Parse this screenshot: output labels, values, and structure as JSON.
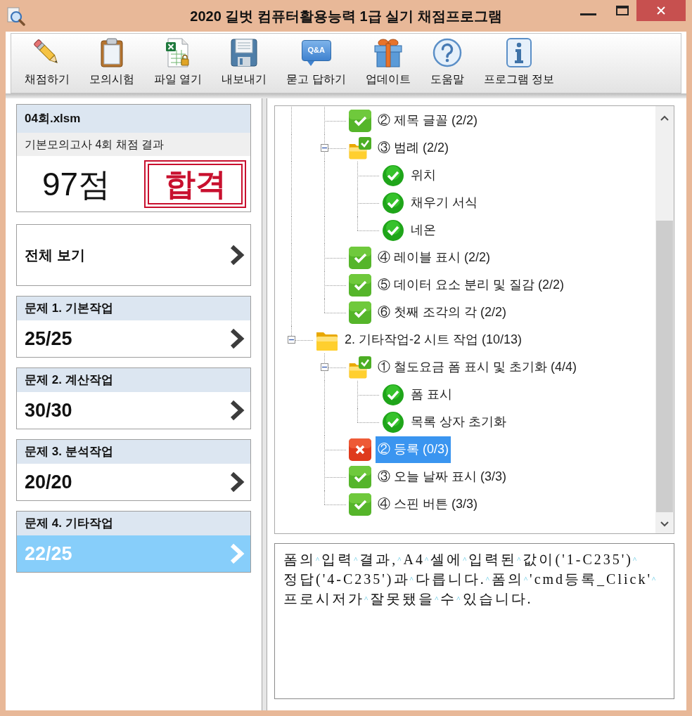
{
  "window": {
    "title": "2020 길벗 컴퓨터활용능력 1급 실기 채점프로그램"
  },
  "toolbar": [
    {
      "label": "채점하기"
    },
    {
      "label": "모의시험"
    },
    {
      "label": "파일 열기"
    },
    {
      "label": "내보내기"
    },
    {
      "label": "묻고 답하기",
      "bubble_text": "Q&A"
    },
    {
      "label": "업데이트"
    },
    {
      "label": "도움말"
    },
    {
      "label": "프로그램 정보"
    }
  ],
  "result": {
    "file": "04회.xlsm",
    "subtitle": "기본모의고사 4회 채점 결과",
    "score": "97점",
    "stamp": "합격"
  },
  "overview": {
    "label": "전체 보기"
  },
  "sections": [
    {
      "title": "문제 1. 기본작업",
      "score": "25/25",
      "selected": false
    },
    {
      "title": "문제 2. 계산작업",
      "score": "30/30",
      "selected": false
    },
    {
      "title": "문제 3. 분석작업",
      "score": "20/20",
      "selected": false
    },
    {
      "title": "문제 4. 기타작업",
      "score": "22/25",
      "selected": true
    }
  ],
  "tree": {
    "nodes": [
      {
        "children": [
          {
            "kind": "item",
            "passed": true,
            "label": "② 제목 글꼴 (2/2)",
            "selected": false
          },
          {
            "kind": "group",
            "passed": true,
            "label": "③ 범례 (2/2)",
            "selected": false,
            "expanded": true,
            "children": [
              {
                "kind": "point",
                "passed": true,
                "label": "위치",
                "selected": false
              },
              {
                "kind": "point",
                "passed": true,
                "label": "채우기 서식",
                "selected": false
              },
              {
                "kind": "point",
                "passed": true,
                "label": "네온",
                "selected": false
              }
            ]
          },
          {
            "kind": "item",
            "passed": true,
            "label": "④ 레이블 표시 (2/2)",
            "selected": false
          },
          {
            "kind": "item",
            "passed": true,
            "label": "⑤ 데이터 요소 분리 및 질감 (2/2)",
            "selected": false
          },
          {
            "kind": "item",
            "passed": true,
            "label": "⑥ 첫째 조각의 각 (2/2)",
            "selected": false
          }
        ]
      },
      {
        "kind": "group",
        "label": "2. 기타작업-2 시트 작업 (10/13)",
        "selected": false,
        "expanded": true,
        "children": [
          {
            "kind": "group",
            "passed": true,
            "label": "① 철도요금 폼 표시 및 초기화 (4/4)",
            "selected": false,
            "expanded": true,
            "children": [
              {
                "kind": "point",
                "passed": true,
                "label": "폼 표시",
                "selected": false
              },
              {
                "kind": "point",
                "passed": true,
                "label": "목록 상자 초기화",
                "selected": false
              }
            ]
          },
          {
            "kind": "item",
            "passed": false,
            "label": "② 등록 (0/3)",
            "selected": true
          },
          {
            "kind": "item",
            "passed": true,
            "label": "③ 오늘 날짜 표시 (3/3)",
            "selected": false
          },
          {
            "kind": "item",
            "passed": true,
            "label": "④ 스핀 버튼 (3/3)",
            "selected": false
          }
        ]
      }
    ]
  },
  "message": "폼의^입력^결과,^A4^셀에^입력된^값이('1-C235')^정답('4-C235')과^다릅니다.^폼의^'cmd등록_Click'^프로시저가^잘못됐을^수^있습니다."
}
